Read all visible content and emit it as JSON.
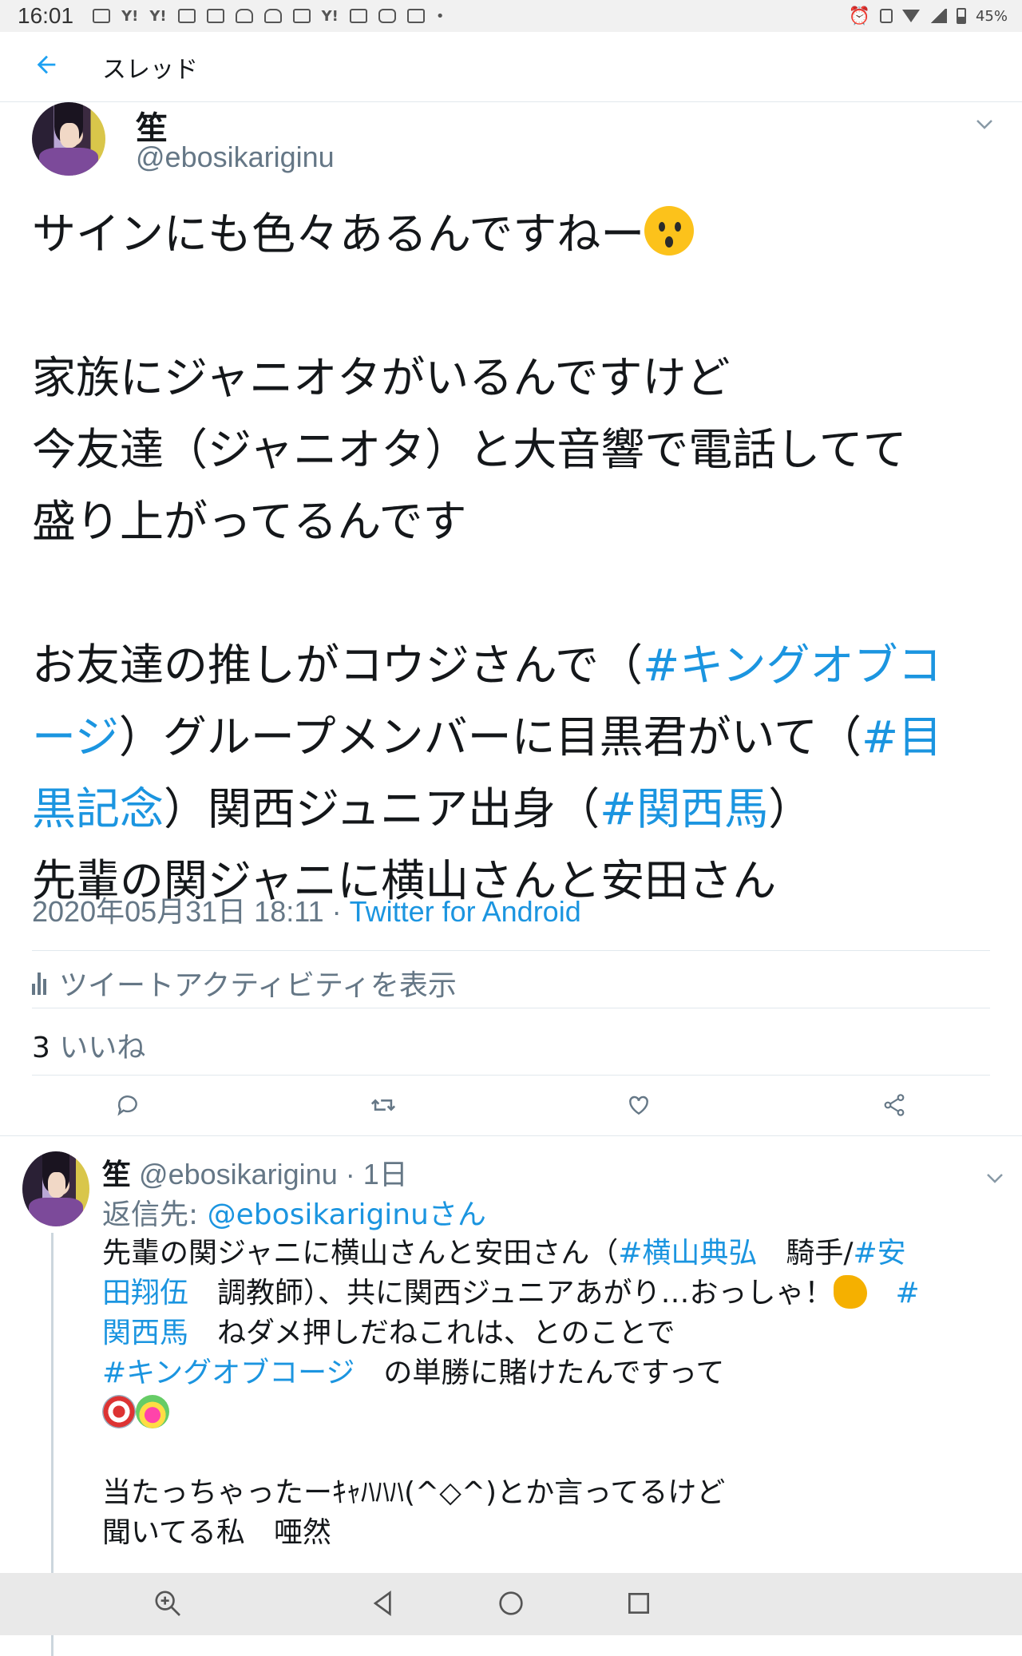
{
  "status_bar": {
    "time": "16:01",
    "battery": "45%",
    "icons": [
      "photo-icon",
      "yahoo-icon",
      "yahoo-icon",
      "app-icon",
      "app-icon",
      "android-icon",
      "android-icon",
      "mail-icon",
      "yahoo-icon",
      "app-icon",
      "train-icon",
      "apps-icon",
      "dot-icon",
      "alarm-icon",
      "vibrate-icon",
      "wifi-icon",
      "signal-icon",
      "battery-icon"
    ]
  },
  "app_bar": {
    "title": "スレッド",
    "back_icon": "arrow-left-icon"
  },
  "main_tweet": {
    "name": "笙",
    "handle": "@ebosikariginu",
    "text": {
      "l1": "サインにも色々あるんですねー",
      "l2": "家族にジャニオタがいるんですけど",
      "l3": "今友達（ジャニオタ）と大音響で電話してて",
      "l4": "盛り上がってるんです",
      "l5a": "お友達の推しがコウジさんで（",
      "tag1a": "#キングオブコ",
      "tag1b": "ージ",
      "l6a": "）グループメンバーに目黒君がいて（",
      "tag2a": "#目",
      "tag2b": "黒記念",
      "l7a": "）関西ジュニア出身（",
      "tag3": "#関西馬",
      "l7b": "）",
      "l8": "先輩の関ジャニに横山さんと安田さん"
    },
    "date": "2020年05月31日 18:11",
    "source_sep": " · ",
    "source": "Twitter for Android",
    "activity_label": "ツイートアクティビティを表示",
    "likes_count": "3",
    "likes_label": "いいね"
  },
  "reply_tweet": {
    "name": "笙",
    "handle": "@ebosikariginu",
    "time": "· 1日",
    "reply_to_prefix": "返信先: ",
    "reply_to_handle": "@ebosikariginuさん",
    "text": {
      "a1": "先輩の関ジャニに横山さんと安田さん（",
      "t1": "#横山典弘",
      "a2": "　騎手/",
      "t2a": "#安",
      "t2b": "田翔伍",
      "a3": "　調教師）、共に関西ジュニアあがり…おっしゃ！",
      "t3a": "#",
      "t3b": "関西馬",
      "a4": "　ねダメ押しだねこれは、とのことで",
      "t4": "#キングオブコージ",
      "a5": "　の単勝に賭けたんですって",
      "a6": "当たっちゃったーｷｬﾊﾊﾊ(^◇^)とか言ってるけど",
      "a7": "聞いてる私　唖然"
    }
  },
  "nav_bar": {
    "buttons": [
      "zoom-icon",
      "back-triangle-icon",
      "home-circle-icon",
      "recents-square-icon"
    ]
  }
}
